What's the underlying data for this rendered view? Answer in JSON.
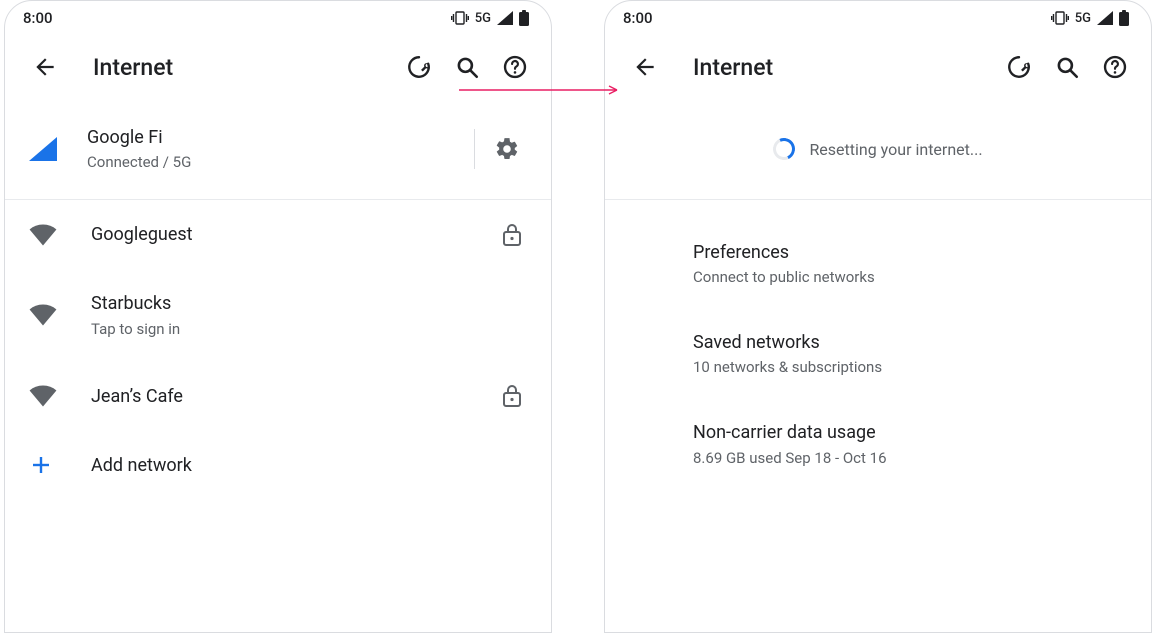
{
  "status": {
    "clock": "8:00",
    "net_label": "5G"
  },
  "header": {
    "title": "Internet"
  },
  "connected": {
    "name": "Google Fi",
    "status": "Connected / 5G"
  },
  "networks": [
    {
      "name": "Googleguest",
      "sub": "",
      "locked": true
    },
    {
      "name": "Starbucks",
      "sub": "Tap to sign in",
      "locked": false
    },
    {
      "name": "Jean’s Cafe",
      "sub": "",
      "locked": true
    }
  ],
  "add_network_label": "Add network",
  "resetting_label": "Resetting your internet...",
  "prefs": [
    {
      "title": "Preferences",
      "sub": "Connect to public networks"
    },
    {
      "title": "Saved networks",
      "sub": "10 networks & subscriptions"
    },
    {
      "title": "Non-carrier data usage",
      "sub": "8.69 GB used Sep 18 - Oct 16"
    }
  ]
}
